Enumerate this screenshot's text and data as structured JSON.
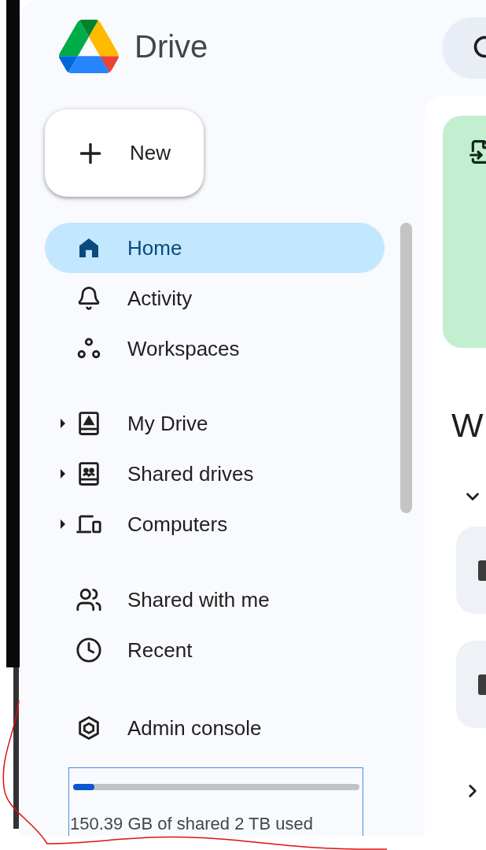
{
  "app": {
    "title": "Drive"
  },
  "new_button": {
    "label": "New"
  },
  "nav": {
    "sections": [
      [
        {
          "label": "Home",
          "selected": true,
          "expandable": false
        },
        {
          "label": "Activity",
          "selected": false,
          "expandable": false
        },
        {
          "label": "Workspaces",
          "selected": false,
          "expandable": false
        }
      ],
      [
        {
          "label": "My Drive",
          "selected": false,
          "expandable": true
        },
        {
          "label": "Shared drives",
          "selected": false,
          "expandable": true
        },
        {
          "label": "Computers",
          "selected": false,
          "expandable": true
        }
      ],
      [
        {
          "label": "Shared with me",
          "selected": false,
          "expandable": false
        },
        {
          "label": "Recent",
          "selected": false,
          "expandable": false
        }
      ],
      [
        {
          "label": "Admin console",
          "selected": false,
          "expandable": false
        }
      ]
    ]
  },
  "storage": {
    "level": 0.075,
    "text": "150.39 GB of shared 2 TB used"
  },
  "main": {
    "heading": "W"
  }
}
